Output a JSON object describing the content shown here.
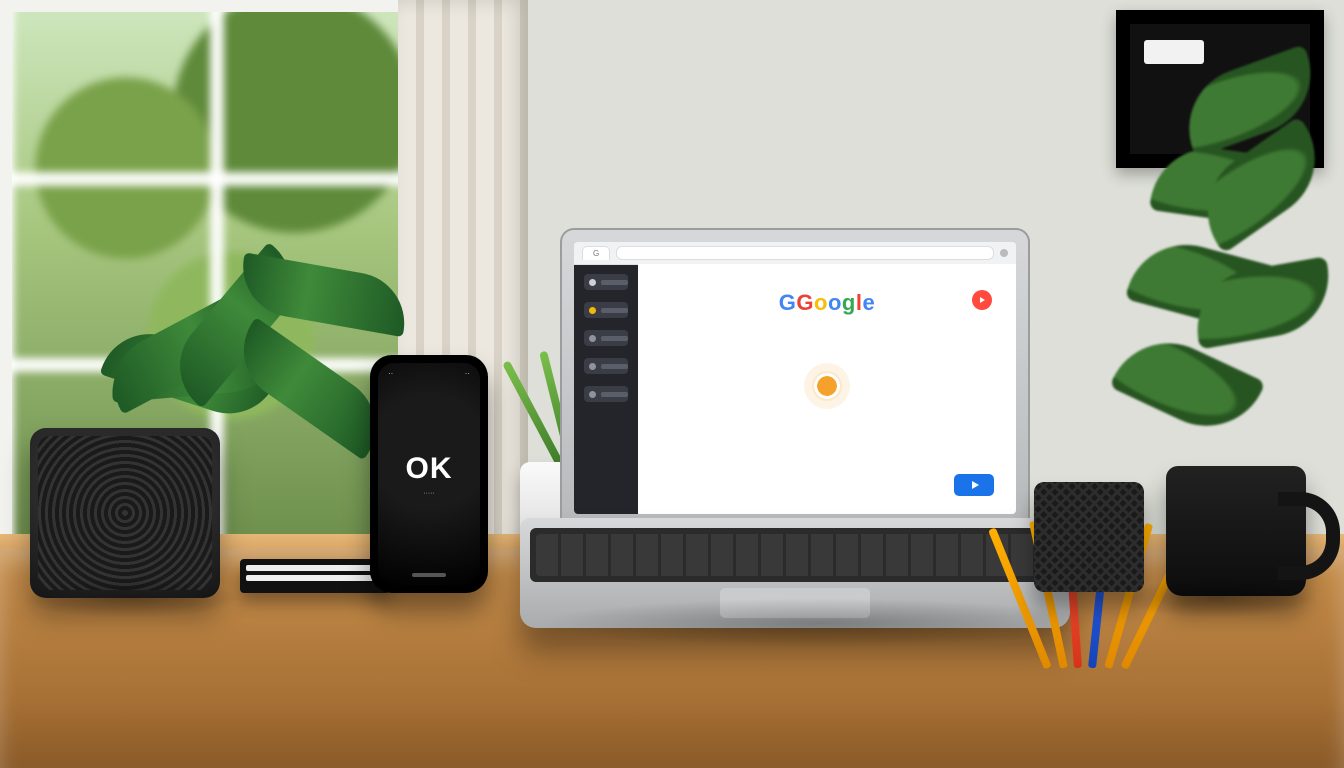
{
  "phone": {
    "status_left": "··",
    "status_right": "··",
    "headline": "OK",
    "subline": "·····"
  },
  "laptop": {
    "browser": {
      "tab_label": "G",
      "sidebar_items": [
        {
          "dot": "#cfcfd6"
        },
        {
          "dot": "#f2b90c"
        },
        {
          "dot": "#8f939c"
        },
        {
          "dot": "#8f939c"
        },
        {
          "dot": "#8f939c"
        }
      ]
    },
    "logo_letters": [
      "G",
      "G",
      "o",
      "o",
      "g",
      "l",
      "e"
    ],
    "subtitle": "",
    "action_button_label": "",
    "brand_label": ""
  },
  "colors": {
    "blue": "#1a73e8",
    "red": "#ff4a3d",
    "orange": "#f6a12b"
  }
}
